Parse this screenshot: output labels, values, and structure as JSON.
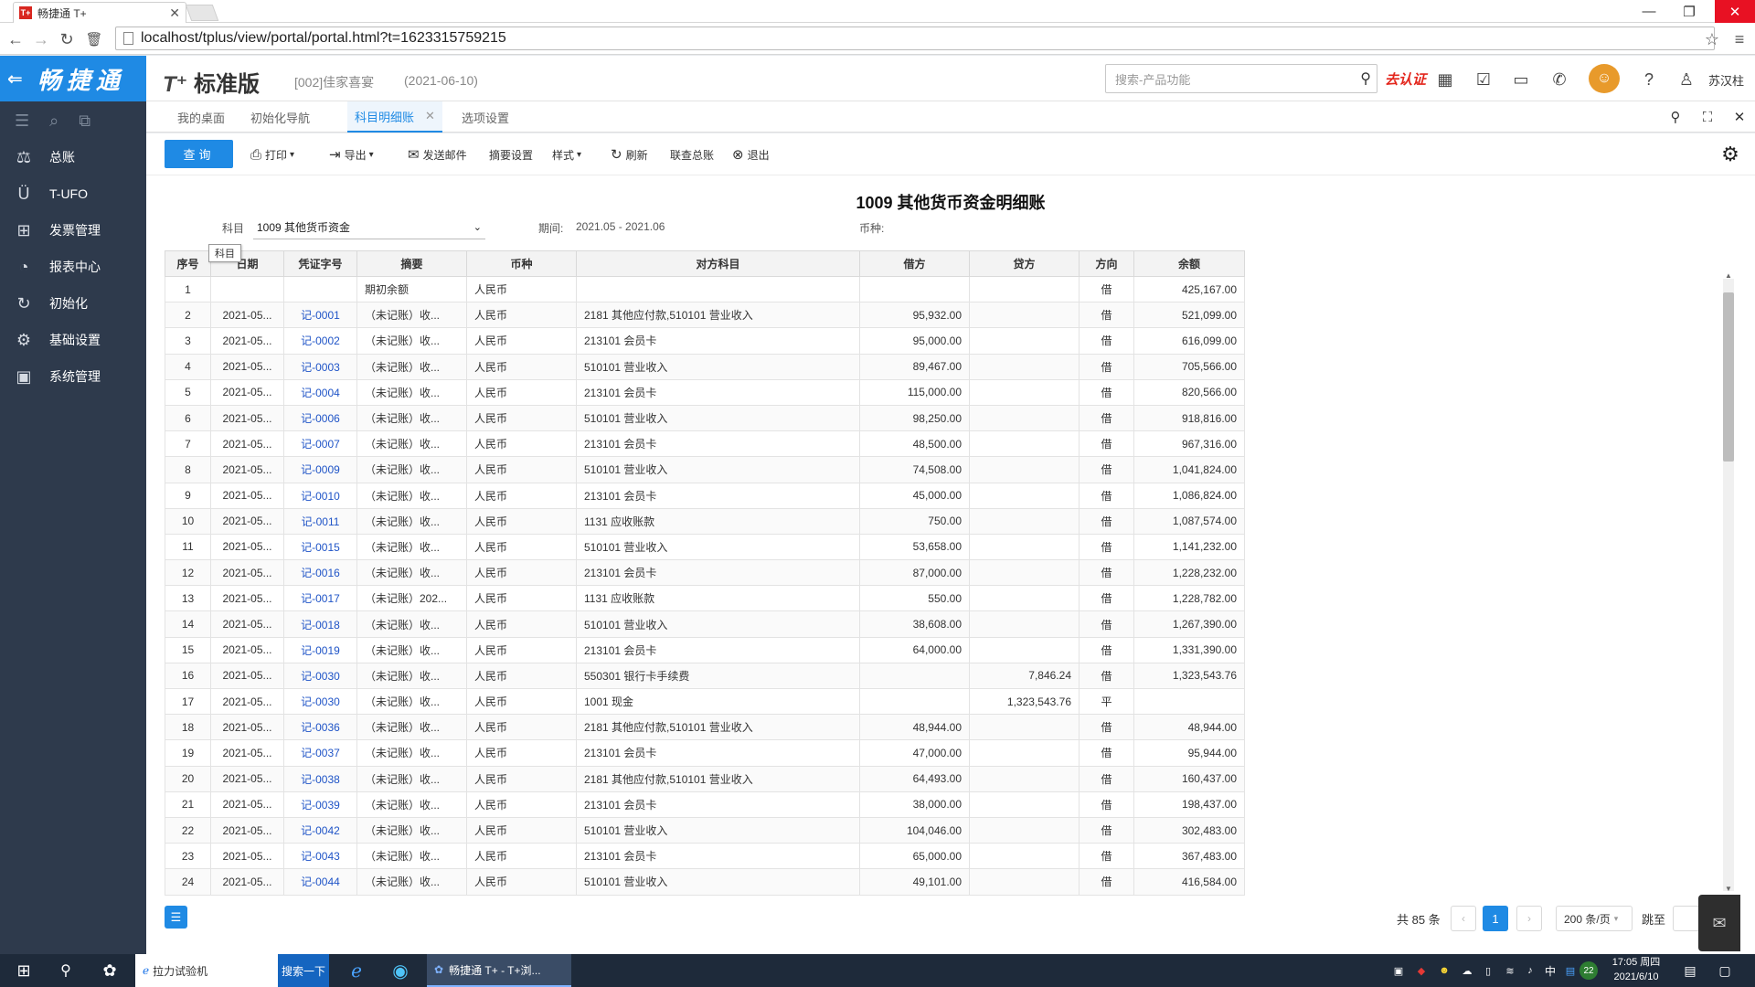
{
  "browser": {
    "tab_title": "畅捷通 T+",
    "favicon": "T+",
    "url": "localhost/tplus/view/portal/portal.html?t=1623315759215"
  },
  "sidebar": {
    "logo": "畅捷通",
    "items": [
      {
        "label": "总账",
        "icon": "ledger-icon"
      },
      {
        "label": "T-UFO",
        "icon": "ufo-icon"
      },
      {
        "label": "发票管理",
        "icon": "invoice-icon"
      },
      {
        "label": "报表中心",
        "icon": "report-icon"
      },
      {
        "label": "初始化",
        "icon": "init-icon"
      },
      {
        "label": "基础设置",
        "icon": "settings-icon"
      },
      {
        "label": "系统管理",
        "icon": "system-icon"
      }
    ]
  },
  "header": {
    "brand_t": "T⁺",
    "brand_text": "标准版",
    "company": "[002]佳家喜宴",
    "date": "(2021-06-10)",
    "search_placeholder": "搜索-产品功能",
    "auth": "去认证",
    "user": "苏汉柱"
  },
  "tabs": [
    "我的桌面",
    "初始化导航",
    "科目明细账",
    "选项设置"
  ],
  "toolbar": {
    "query": "查询",
    "print": "打印",
    "export": "导出",
    "send_mail": "发送邮件",
    "summary_settings": "摘要设置",
    "style": "样式",
    "refresh": "刷新",
    "joint_ledger": "联查总账",
    "exit": "退出"
  },
  "report": {
    "title": "1009 其他货币资金明细账",
    "account_label": "科目",
    "account_value": "1009 其他货币资金",
    "period_label": "期间:",
    "period_value": "2021.05 - 2021.06",
    "currency_label": "币种:",
    "tooltip": "科目"
  },
  "table": {
    "headers": [
      "序号",
      "日期",
      "凭证字号",
      "摘要",
      "币种",
      "对方科目",
      "借方",
      "贷方",
      "方向",
      "余额"
    ],
    "rows": [
      [
        "1",
        "",
        "",
        "期初余额",
        "人民币",
        "",
        "",
        "",
        "借",
        "425,167.00"
      ],
      [
        "2",
        "2021-05...",
        "记-0001",
        "（未记账）收...",
        "人民币",
        "2181 其他应付款,510101 营业收入",
        "95,932.00",
        "",
        "借",
        "521,099.00"
      ],
      [
        "3",
        "2021-05...",
        "记-0002",
        "（未记账）收...",
        "人民币",
        "213101 会员卡",
        "95,000.00",
        "",
        "借",
        "616,099.00"
      ],
      [
        "4",
        "2021-05...",
        "记-0003",
        "（未记账）收...",
        "人民币",
        "510101 营业收入",
        "89,467.00",
        "",
        "借",
        "705,566.00"
      ],
      [
        "5",
        "2021-05...",
        "记-0004",
        "（未记账）收...",
        "人民币",
        "213101 会员卡",
        "115,000.00",
        "",
        "借",
        "820,566.00"
      ],
      [
        "6",
        "2021-05...",
        "记-0006",
        "（未记账）收...",
        "人民币",
        "510101 营业收入",
        "98,250.00",
        "",
        "借",
        "918,816.00"
      ],
      [
        "7",
        "2021-05...",
        "记-0007",
        "（未记账）收...",
        "人民币",
        "213101 会员卡",
        "48,500.00",
        "",
        "借",
        "967,316.00"
      ],
      [
        "8",
        "2021-05...",
        "记-0009",
        "（未记账）收...",
        "人民币",
        "510101 营业收入",
        "74,508.00",
        "",
        "借",
        "1,041,824.00"
      ],
      [
        "9",
        "2021-05...",
        "记-0010",
        "（未记账）收...",
        "人民币",
        "213101 会员卡",
        "45,000.00",
        "",
        "借",
        "1,086,824.00"
      ],
      [
        "10",
        "2021-05...",
        "记-0011",
        "（未记账）收...",
        "人民币",
        "1131 应收账款",
        "750.00",
        "",
        "借",
        "1,087,574.00"
      ],
      [
        "11",
        "2021-05...",
        "记-0015",
        "（未记账）收...",
        "人民币",
        "510101 营业收入",
        "53,658.00",
        "",
        "借",
        "1,141,232.00"
      ],
      [
        "12",
        "2021-05...",
        "记-0016",
        "（未记账）收...",
        "人民币",
        "213101 会员卡",
        "87,000.00",
        "",
        "借",
        "1,228,232.00"
      ],
      [
        "13",
        "2021-05...",
        "记-0017",
        "（未记账）202...",
        "人民币",
        "1131 应收账款",
        "550.00",
        "",
        "借",
        "1,228,782.00"
      ],
      [
        "14",
        "2021-05...",
        "记-0018",
        "（未记账）收...",
        "人民币",
        "510101 营业收入",
        "38,608.00",
        "",
        "借",
        "1,267,390.00"
      ],
      [
        "15",
        "2021-05...",
        "记-0019",
        "（未记账）收...",
        "人民币",
        "213101 会员卡",
        "64,000.00",
        "",
        "借",
        "1,331,390.00"
      ],
      [
        "16",
        "2021-05...",
        "记-0030",
        "（未记账）收...",
        "人民币",
        "550301 银行卡手续费",
        "",
        "7,846.24",
        "借",
        "1,323,543.76"
      ],
      [
        "17",
        "2021-05...",
        "记-0030",
        "（未记账）收...",
        "人民币",
        "1001 现金",
        "",
        "1,323,543.76",
        "平",
        ""
      ],
      [
        "18",
        "2021-05...",
        "记-0036",
        "（未记账）收...",
        "人民币",
        "2181 其他应付款,510101 营业收入",
        "48,944.00",
        "",
        "借",
        "48,944.00"
      ],
      [
        "19",
        "2021-05...",
        "记-0037",
        "（未记账）收...",
        "人民币",
        "213101 会员卡",
        "47,000.00",
        "",
        "借",
        "95,944.00"
      ],
      [
        "20",
        "2021-05...",
        "记-0038",
        "（未记账）收...",
        "人民币",
        "2181 其他应付款,510101 营业收入",
        "64,493.00",
        "",
        "借",
        "160,437.00"
      ],
      [
        "21",
        "2021-05...",
        "记-0039",
        "（未记账）收...",
        "人民币",
        "213101 会员卡",
        "38,000.00",
        "",
        "借",
        "198,437.00"
      ],
      [
        "22",
        "2021-05...",
        "记-0042",
        "（未记账）收...",
        "人民币",
        "510101 营业收入",
        "104,046.00",
        "",
        "借",
        "302,483.00"
      ],
      [
        "23",
        "2021-05...",
        "记-0043",
        "（未记账）收...",
        "人民币",
        "213101 会员卡",
        "65,000.00",
        "",
        "借",
        "367,483.00"
      ],
      [
        "24",
        "2021-05...",
        "记-0044",
        "（未记账）收...",
        "人民币",
        "510101 营业收入",
        "49,101.00",
        "",
        "借",
        "416,584.00"
      ]
    ]
  },
  "pager": {
    "total": "共 85 条",
    "current": "1",
    "size": "200 条/页",
    "jump": "跳至"
  },
  "taskbar": {
    "search_text": "拉力试验机",
    "search_btn": "搜索一下",
    "app": "畅捷通 T+ - T+浏...",
    "time": "17:05 周四",
    "date": "2021/6/10",
    "badge": "22"
  }
}
